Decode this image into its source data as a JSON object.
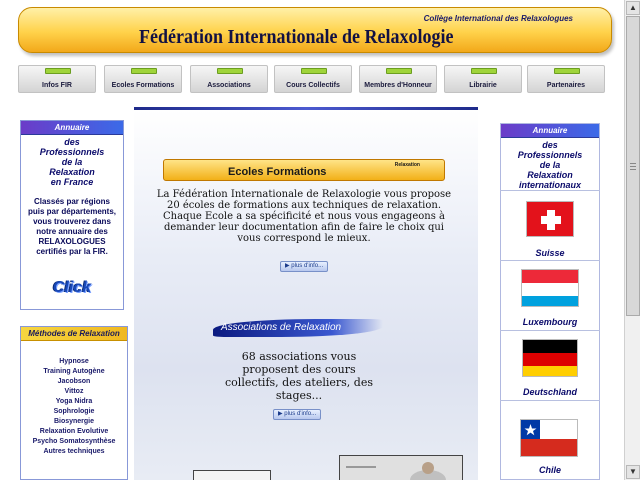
{
  "header": {
    "subtitle": "Collège International des Relaxologues",
    "title": "Fédération Internationale de Relaxologie"
  },
  "nav": [
    {
      "label": "Infos FIR"
    },
    {
      "label": "Ecoles Formations"
    },
    {
      "label": "Associations"
    },
    {
      "label": "Cours Collectifs"
    },
    {
      "label": "Membres d'Honneur"
    },
    {
      "label": "Librairie"
    },
    {
      "label": "Partenaires"
    }
  ],
  "left_annuaire": {
    "heading": "Annuaire",
    "lines": [
      "des",
      "Professionnels",
      "de la",
      "Relaxation",
      "en France"
    ],
    "description": "Classés par régions puis par départements, vous trouverez dans notre annuaire des RELAXOLOGUES certifiés par la FIR.",
    "click_label": "Click"
  },
  "methods": {
    "heading": "Méthodes de Relaxation",
    "items": [
      "Hypnose",
      "Training Autogène",
      "Jacobson",
      "Vittoz",
      "Yoga Nidra",
      "Sophrologie",
      "Biosynergie",
      "Relaxation Evolutive",
      "Psycho Somatosynthèse",
      "Autres techniques"
    ]
  },
  "ecoles": {
    "banner_title": "Ecoles Formations",
    "banner_tag": "Relaxation",
    "text": "La Fédération Internationale de Relaxologie vous propose 20 écoles de formations aux techniques de relaxation.",
    "text2": "Chaque Ecole a sa spécificité et nous vous engageons à demander leur documentation afin de faire le choix qui vous correspond le mieux.",
    "more": "▶ plus d'info..."
  },
  "associations": {
    "banner": "Associations de Relaxation",
    "text": "68 associations vous proposent des cours collectifs, des ateliers, des stages...",
    "more": "▶ plus d'info..."
  },
  "right_annuaire": {
    "heading": "Annuaire",
    "lines": [
      "des",
      "Professionnels",
      "de la",
      "Relaxation",
      "internationaux"
    ],
    "countries": [
      {
        "name": "Suisse"
      },
      {
        "name": "Luxembourg"
      },
      {
        "name": "Deutschland"
      },
      {
        "name": "Chile"
      }
    ]
  },
  "colors": {
    "header_gold": "#ffd24a",
    "nav_accent": "#9fd43a",
    "annuaire_purple": "#6b3cc8",
    "link_blue": "#1848b8"
  }
}
